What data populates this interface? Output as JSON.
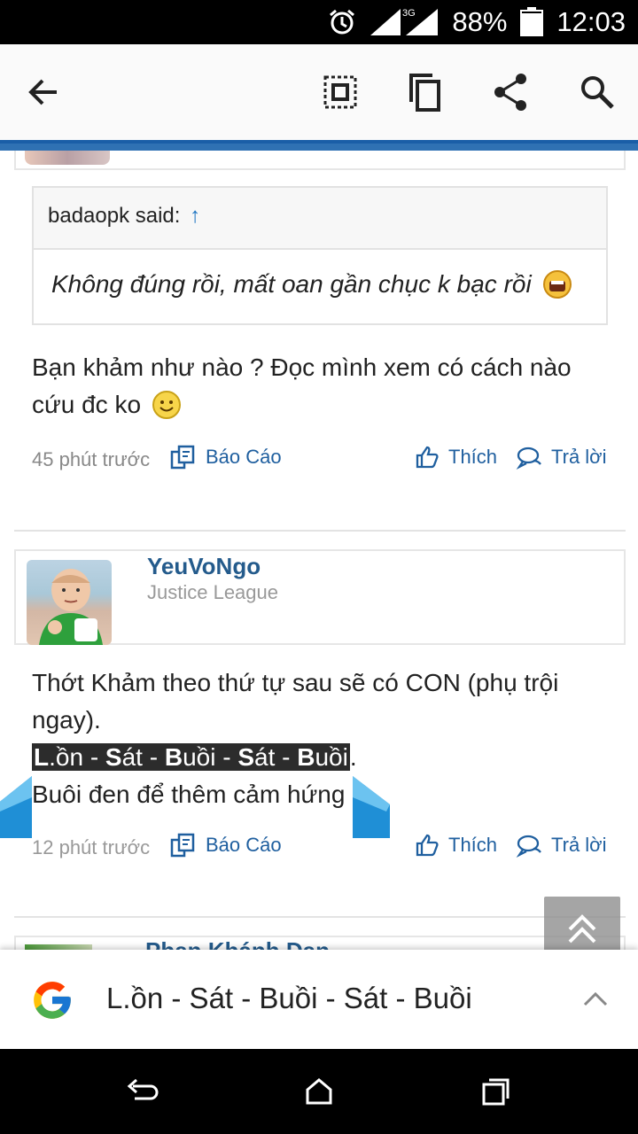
{
  "status_bar": {
    "network": "3G",
    "battery": "88%",
    "time": "12:03"
  },
  "action_bar": {
    "icons": [
      "back-arrow-icon",
      "select-all-icon",
      "copy-icon",
      "share-icon",
      "search-icon"
    ]
  },
  "quote": {
    "author_label": "badaopk said:",
    "arrow": "↑",
    "text": "Không đúng rồi, mất oan gần chục k bạc rồi"
  },
  "post1": {
    "text_line1": "Bạn khảm như nào ? Đọc mình xem có cách nào",
    "text_line2": "cứu đc ko",
    "time": "45 phút trước",
    "report": "Báo Cáo",
    "like": "Thích",
    "reply": "Trả lời"
  },
  "post2": {
    "username": "YeuVoNgo",
    "user_title": "Justice League",
    "line1": "Thớt Khảm theo thứ tự sau sẽ có CON (phụ trội",
    "line2": "ngay).",
    "sel_L": "L",
    "sel_part1": ".ồn - ",
    "sel_S1": "S",
    "sel_part2": "át - ",
    "sel_B1": "B",
    "sel_part3": "uồi - ",
    "sel_S2": "S",
    "sel_part4": "át - ",
    "sel_B2": "B",
    "sel_part5": "uồi",
    "sel_after": ".",
    "line4": "Buôi đen để thêm cảm hứng",
    "time": "12 phút trước",
    "report": "Báo Cáo",
    "like": "Thích",
    "reply": "Trả lời"
  },
  "post3": {
    "username": "Phan Khánh Dạn"
  },
  "search_sheet": {
    "query": "L.ồn - Sát - Buồi - Sát - Buồi"
  },
  "colors": {
    "link": "#1f5f9f",
    "username": "#245b8c",
    "accent_bar": "#2f71b3",
    "handle": "#1f8fd6"
  }
}
